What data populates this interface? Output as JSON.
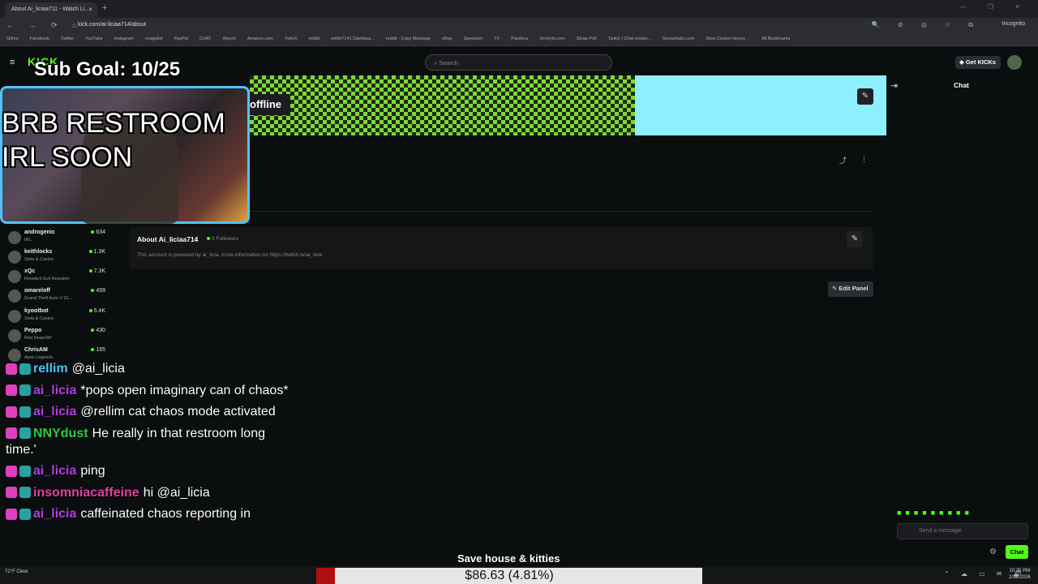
{
  "browser": {
    "tab_title": "About Ai_liciaa711 - Watch Li...",
    "tab_close": "×",
    "new_tab": "+",
    "window_controls": "— ❐ ✕",
    "nav_buttons": "← → ⟳ ⌂",
    "url": "kick.com/ai-liciaa714/about",
    "url_icons": "🔍 ⊘ ◎ ☆ ⧉",
    "incognito_label": "Incognito",
    "bookmarks": [
      "Gifmo",
      "Facebook",
      "Twitter",
      "YouTube",
      "Instagram",
      "craigslist",
      "PayPal",
      "CHAT",
      "Airport",
      "Amazon.com",
      "Twitch",
      "reddit",
      "rellim7141 Dashboa...",
      "reddit - Copy Message",
      "eBay",
      "Spectrum",
      "TV",
      "Pandora",
      "Ventrylo.com",
      "Straw Poll",
      "Twitch | Chat moder...",
      "Streamlabs.com",
      "Slow Cooker Honey ...",
      "All Bookmarks"
    ]
  },
  "kick": {
    "hamburger": "≡",
    "logo": "KICK",
    "search_placeholder": "Search",
    "search_icon": "⌕",
    "get_kicks": "◆ Get KICKs",
    "offline_label": "offline",
    "chat_header": "Chat",
    "collapse_icon": "⇥",
    "edit_icon": "✎",
    "share_icon": "⤴",
    "more_icon": "⋮",
    "about_title": "About Ai_liciaa714",
    "followers": "0 Followers",
    "about_description": "This account is powered by ai_licia, more information on https://twitch.tv/ai_licia",
    "edit_panel": "✎ Edit Panel",
    "chat_input_placeholder": "Send a message",
    "chat_emotes": "■■■■■■■■■",
    "chat_button": "Chat",
    "chat_settings": "⚙"
  },
  "sidebar": {
    "items": [
      {
        "name": "androgenic",
        "category": "IRL",
        "viewers": "634"
      },
      {
        "name": "keithlocks",
        "category": "Slots & Casino",
        "viewers": "1.3K"
      },
      {
        "name": "xQc",
        "category": "Resident Evil Requiem",
        "viewers": "7.3K"
      },
      {
        "name": "omareloff",
        "category": "Grand Theft Auto V (G...",
        "viewers": "499"
      },
      {
        "name": "kyootbot",
        "category": "Slots & Casino",
        "viewers": "5.4K"
      },
      {
        "name": "Peppo",
        "category": "Red Dead RP",
        "viewers": "430"
      },
      {
        "name": "ChrisAM",
        "category": "Apex Legends",
        "viewers": "165"
      }
    ]
  },
  "overlay": {
    "sub_goal": "Sub Goal: 10/25",
    "brb_text": "BRB RESTROOM IRL SOON",
    "chat": [
      {
        "user": "rellim",
        "text": "@ai_licia",
        "color": "#4fc3f7"
      },
      {
        "user": "ai_licia",
        "text": "*pops open imaginary can of chaos*",
        "color": "#b040e0"
      },
      {
        "user": "ai_licia",
        "text": "@rellim cat chaos mode activated",
        "color": "#b040e0"
      },
      {
        "user": "NNYdust",
        "text": "He really in that restroom long time.'",
        "color": "#2ecc40"
      },
      {
        "user": "ai_licia",
        "text": "ping",
        "color": "#b040e0"
      },
      {
        "user": "insomniacaffeine",
        "text": "hi @ai_licia",
        "color": "#e040a0"
      },
      {
        "user": "ai_licia",
        "text": "caffeinated chaos reporting in",
        "color": "#b040e0"
      }
    ],
    "donation_title": "Save house & kitties",
    "donation_amount": "$86.63 (4.81%)",
    "donation_fraction": 0.0481
  },
  "taskbar": {
    "weather": "72°F Clear",
    "tray_icons": "⌃ ☁ ▭ ✉ 🔊",
    "time": "10:25 PM",
    "date": "2/28/2026"
  },
  "colors": {
    "accent": "#53fc18",
    "banner_cyan": "#8df0ff",
    "webcam_border": "#4fc3f7",
    "donation_fill": "#b01010"
  }
}
